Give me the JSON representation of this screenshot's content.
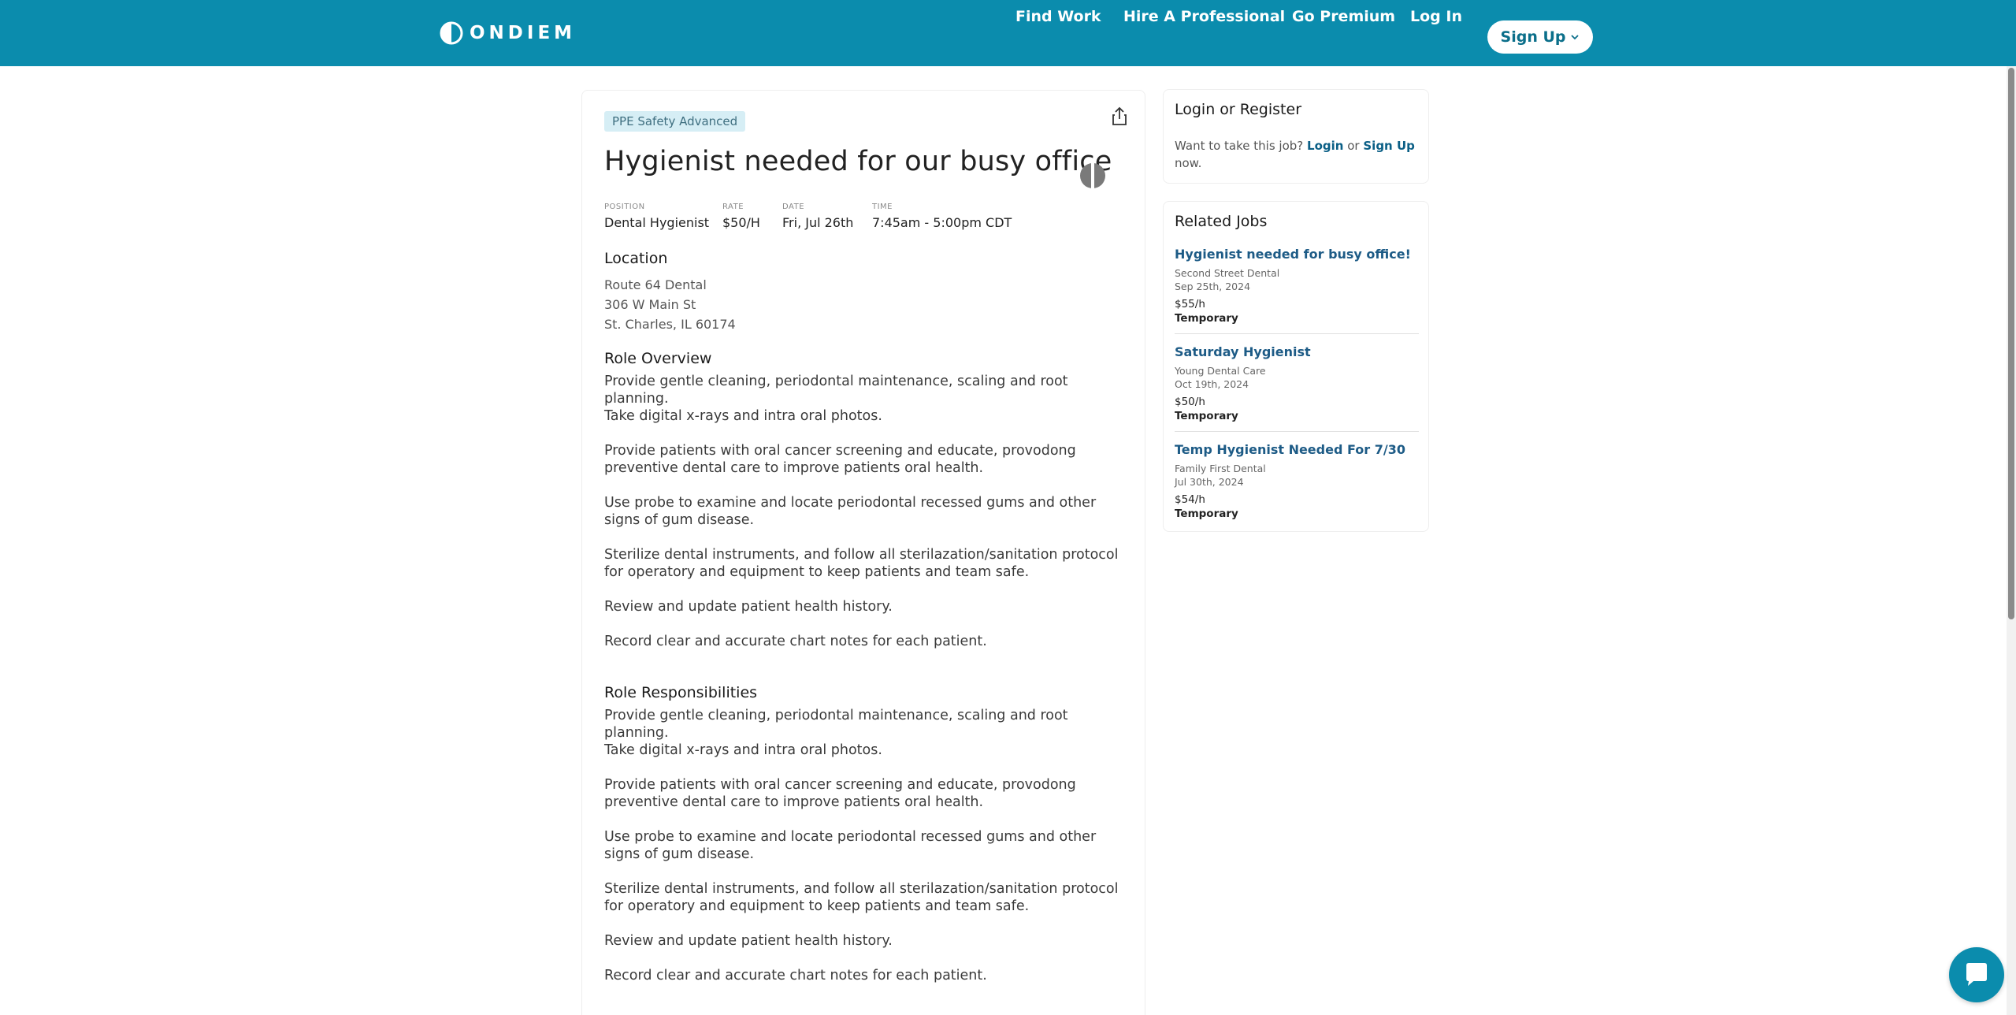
{
  "header": {
    "logo_text": "ONDIEM",
    "nav": [
      "Find Work",
      "Hire A Professional",
      "Go Premium",
      "Log In"
    ],
    "signup_label": "Sign Up",
    "brand_color": "#0b8cad"
  },
  "job": {
    "badge": "PPE Safety Advanced",
    "title": "Hygienist needed for our busy office",
    "meta": [
      {
        "label": "Position",
        "value": "Dental Hygienist"
      },
      {
        "label": "Rate",
        "value": "$50/H"
      },
      {
        "label": "Date",
        "value": "Fri, Jul 26th"
      },
      {
        "label": "Time",
        "value": "7:45am - 5:00pm CDT"
      }
    ],
    "location_heading": "Location",
    "address": [
      "Route 64 Dental",
      "306 W Main St",
      "St. Charles, IL 60174"
    ],
    "overview_heading": "Role Overview",
    "overview": [
      "Provide gentle cleaning, periodontal maintenance, scaling and root planning.",
      "Take digital x-rays and intra oral photos.",
      "Provide patients with oral cancer screening and educate, provodong preventive dental care to improve patients oral health.",
      "Use probe to examine and locate periodontal recessed gums and other signs of gum disease.",
      "Sterilize dental instruments, and follow all sterilazation/sanitation protocol for operatory and equipment to keep patients and team safe.",
      "Review and update patient health history.",
      "Record clear and accurate chart notes for each patient."
    ],
    "responsibilities_heading": "Role Responsibilities",
    "responsibilities": [
      "Provide gentle cleaning, periodontal maintenance, scaling and root planning.",
      "Take digital x-rays and intra oral photos.",
      "Provide patients with oral cancer screening and educate, provodong preventive dental care to improve patients oral health.",
      "Use probe to examine and locate periodontal recessed gums and other signs of gum disease.",
      "Sterilize dental instruments, and follow all sterilazation/sanitation protocol for operatory and equipment to keep patients and team safe.",
      "Review and update patient health history.",
      "Record clear and accurate chart notes for each patient."
    ]
  },
  "login": {
    "title": "Login or Register",
    "text_before": "Want to take this job?",
    "login_link": "Login",
    "or_text": "or",
    "signup_link": "Sign Up",
    "text_after": "now."
  },
  "related": {
    "title": "Related Jobs",
    "items": [
      {
        "title": "Hygienist needed for busy office!",
        "office": "Second Street Dental",
        "date": "Sep 25th, 2024",
        "rate": "$55/h",
        "type": "Temporary"
      },
      {
        "title": "Saturday Hygienist",
        "office": "Young Dental Care",
        "date": "Oct 19th, 2024",
        "rate": "$50/h",
        "type": "Temporary"
      },
      {
        "title": "Temp Hygienist Needed For 7/30",
        "office": "Family First Dental",
        "date": "Jul 30th, 2024",
        "rate": "$54/h",
        "type": "Temporary"
      }
    ]
  },
  "icons": {
    "share": "share-icon",
    "chat": "chat-icon",
    "logo": "ondiem-logo-icon"
  }
}
